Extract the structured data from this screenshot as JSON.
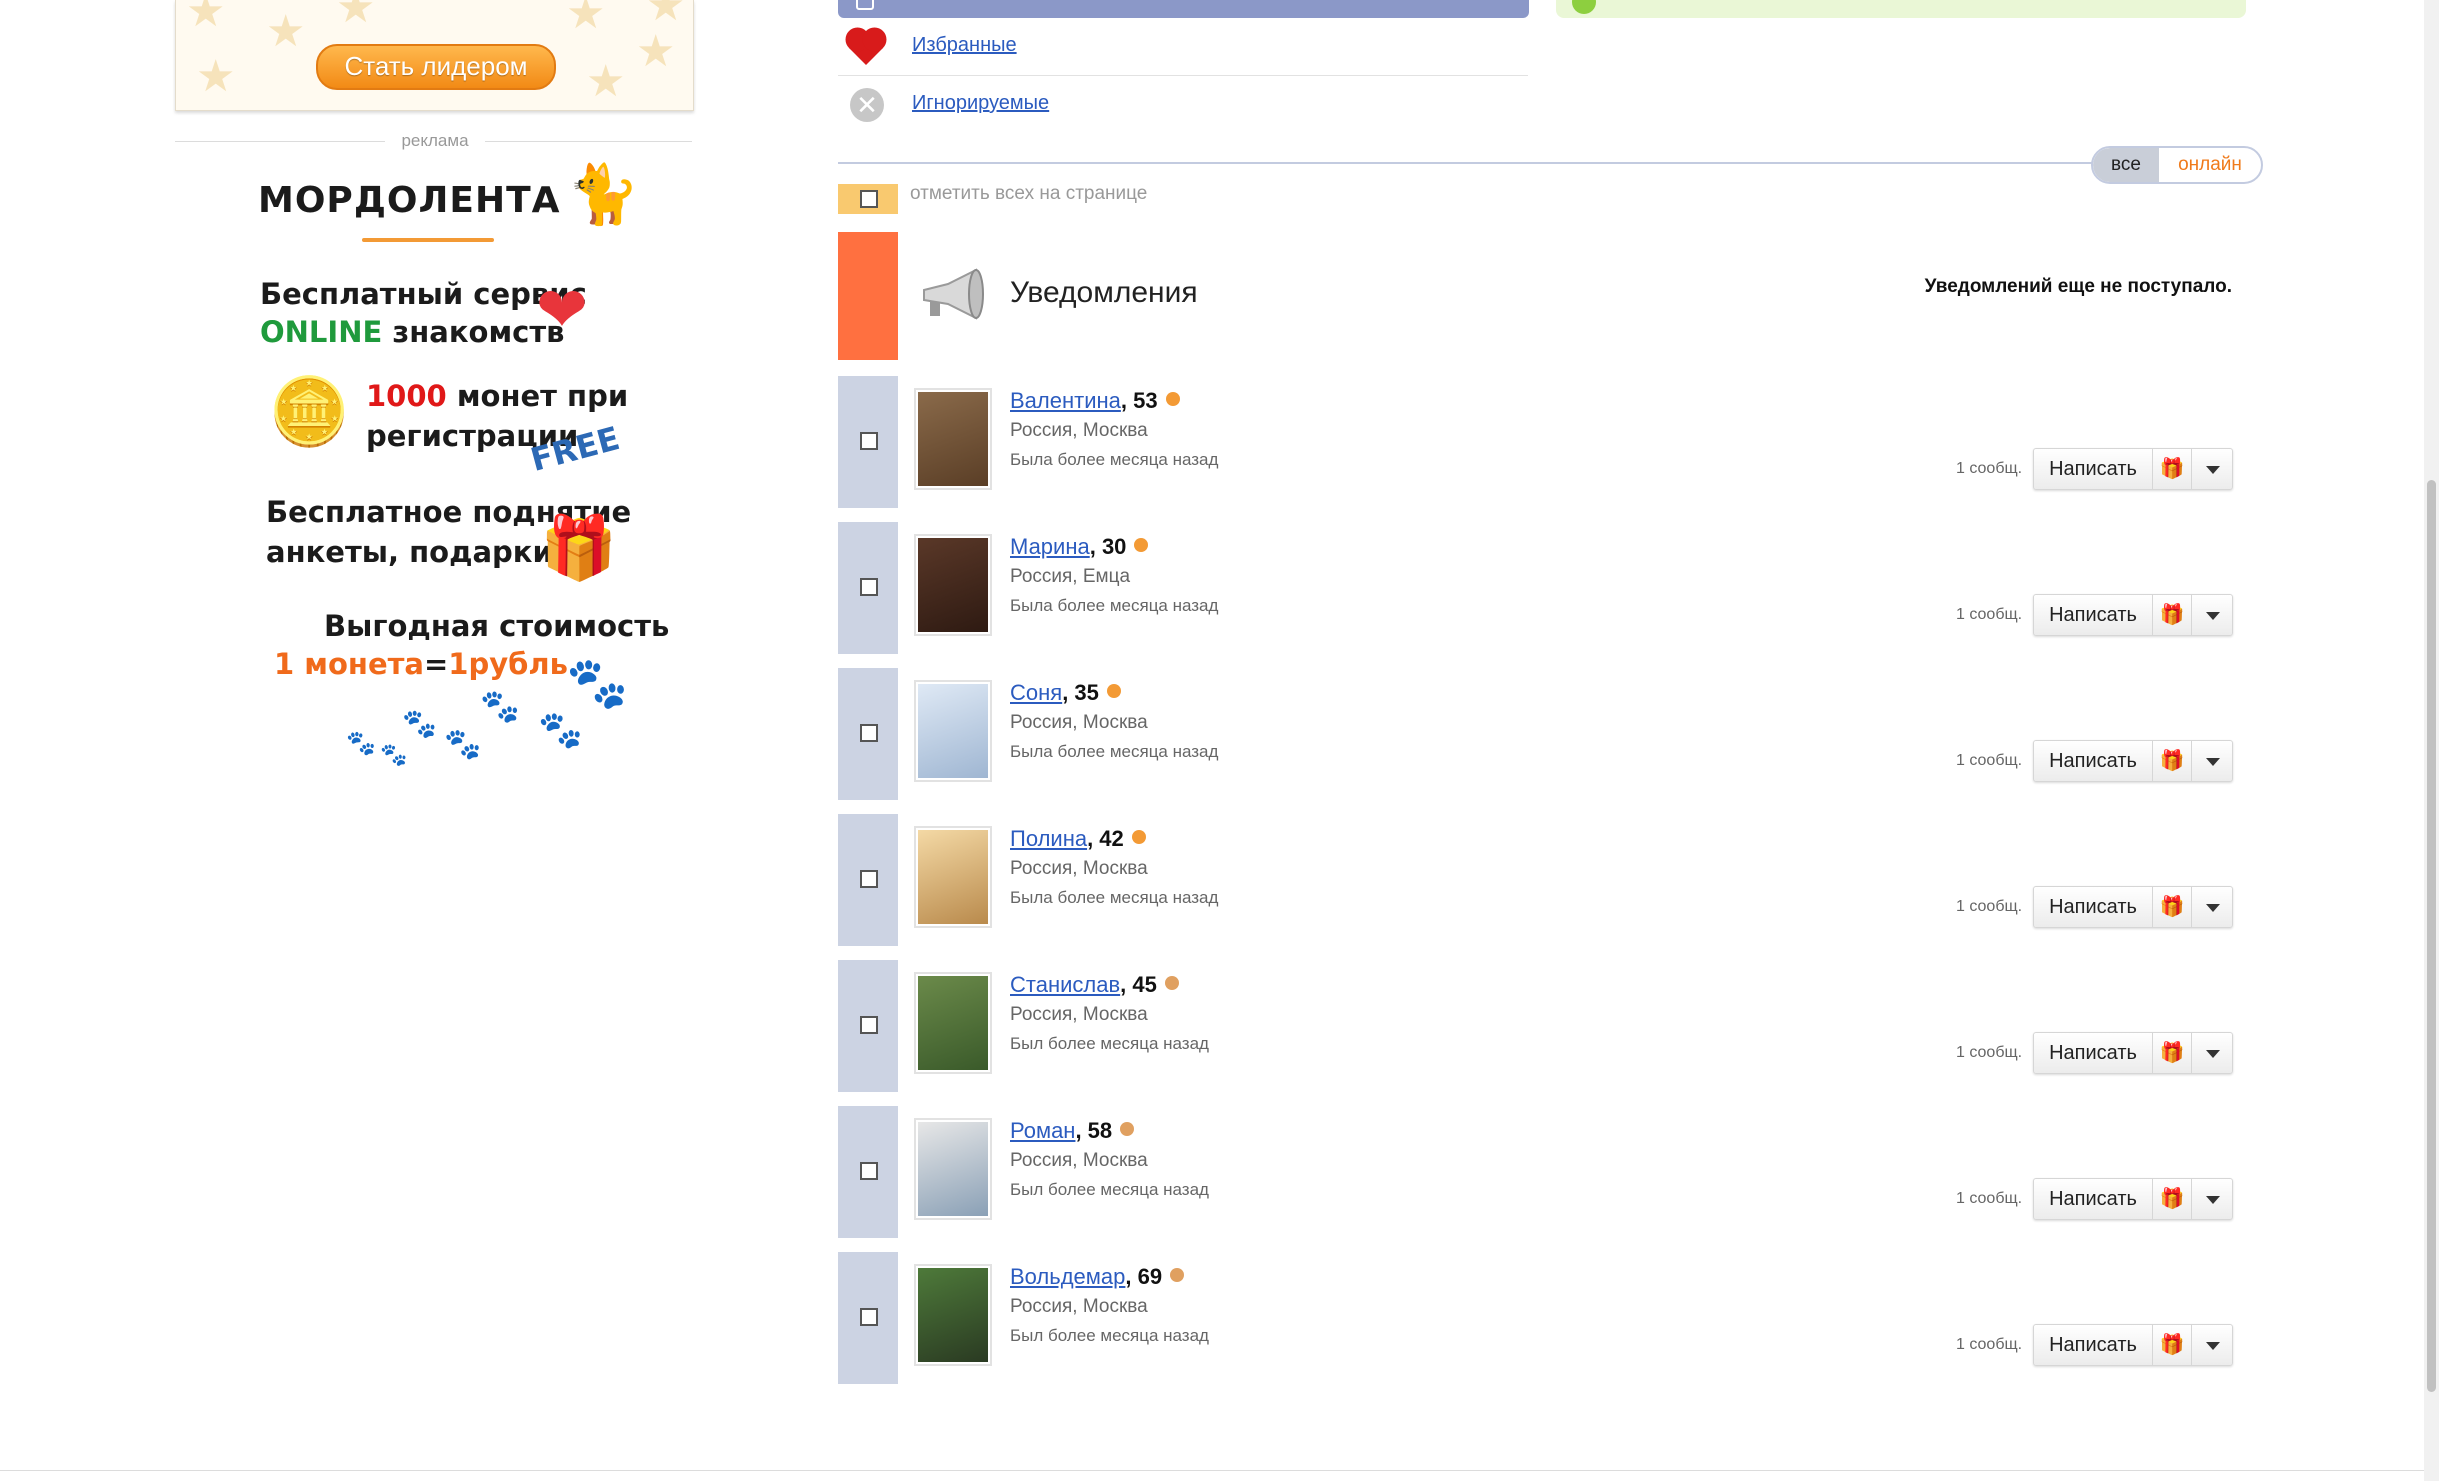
{
  "leader": {
    "button_label": "Стать лидером"
  },
  "ad": {
    "label": "реклама",
    "logo_text": "МОРДОЛЕНТА",
    "line1a": "Бесплатный сервис",
    "line1b_green": "ONLINE",
    "line1b_rest": " знакомств",
    "line2a_red": "1000",
    "line2a_rest": " монет при",
    "line2b": "регистрации",
    "free": "FREE",
    "line3a": "Бесплатное поднятие",
    "line3b": "анкеты, подарки",
    "line4a": "Выгодная стоимость",
    "line4b_orange1": "1 монета",
    "line4b_eq": "=",
    "line4b_orange2": "1рубль"
  },
  "menu": {
    "favorites": "Избранные",
    "ignored": "Игнорируемые"
  },
  "filter": {
    "all": "все",
    "online": "онлайн"
  },
  "select_all": "отметить всех на странице",
  "notifications": {
    "title": "Уведомления",
    "empty": "Уведомлений еще не поступало."
  },
  "contacts": [
    {
      "name": "Валентина",
      "age": ", 53",
      "gender": "female",
      "location": "Россия, Москва",
      "seen": "Была более месяца назад",
      "msgs": "1 сообщ.",
      "write": "Написать"
    },
    {
      "name": "Марина",
      "age": ", 30",
      "gender": "female",
      "location": "Россия, Емца",
      "seen": "Была более месяца назад",
      "msgs": "1 сообщ.",
      "write": "Написать"
    },
    {
      "name": "Соня",
      "age": ", 35",
      "gender": "female",
      "location": "Россия, Москва",
      "seen": "Была более месяца назад",
      "msgs": "1 сообщ.",
      "write": "Написать"
    },
    {
      "name": "Полина",
      "age": ", 42",
      "gender": "female",
      "location": "Россия, Москва",
      "seen": "Была более месяца назад",
      "msgs": "1 сообщ.",
      "write": "Написать"
    },
    {
      "name": "Станислав",
      "age": ", 45",
      "gender": "male",
      "location": "Россия, Москва",
      "seen": "Был более месяца назад",
      "msgs": "1 сообщ.",
      "write": "Написать"
    },
    {
      "name": "Роман",
      "age": ", 58",
      "gender": "male",
      "location": "Россия, Москва",
      "seen": "Был более месяца назад",
      "msgs": "1 сообщ.",
      "write": "Написать"
    },
    {
      "name": "Вольдемар",
      "age": ", 69",
      "gender": "male",
      "location": "Россия, Москва",
      "seen": "Был более месяца назад",
      "msgs": "1 сообщ.",
      "write": "Написать"
    }
  ],
  "colors": {
    "link": "#2b5bbf",
    "accent_orange": "#ff7040",
    "row_strip": "#ccd3e3",
    "female_icon": "#f39a35",
    "male_icon": "#e0a060"
  }
}
